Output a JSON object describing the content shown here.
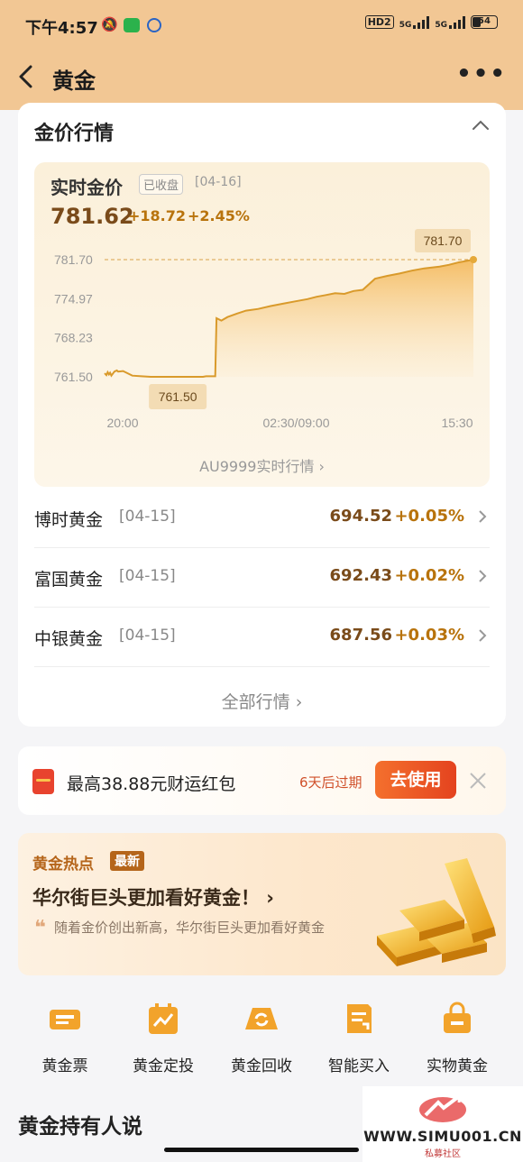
{
  "status_bar": {
    "time": "下午4:57",
    "hd": "HD2",
    "net1": "5G",
    "net2": "5G",
    "battery": "54"
  },
  "nav": {
    "title": "黄金"
  },
  "market": {
    "section_title": "金价行情",
    "realtime": {
      "title": "实时金价",
      "badge": "已收盘",
      "date": "[04-16]",
      "price": "781.62",
      "change": "+18.72",
      "change_pct": "+2.45%",
      "link": "AU9999实时行情"
    },
    "funds": [
      {
        "name": "博时黄金",
        "date": "[04-15]",
        "price": "694.52",
        "pct": "+0.05%"
      },
      {
        "name": "富国黄金",
        "date": "[04-15]",
        "price": "692.43",
        "pct": "+0.02%"
      },
      {
        "name": "中银黄金",
        "date": "[04-15]",
        "price": "687.56",
        "pct": "+0.03%"
      }
    ],
    "all_link": "全部行情"
  },
  "chart_data": {
    "type": "area",
    "y_ticks": [
      "781.70",
      "774.97",
      "768.23",
      "761.50"
    ],
    "x_ticks": [
      "20:00",
      "02:30/09:00",
      "15:30"
    ],
    "ylim": [
      761.5,
      781.7
    ],
    "high_label": "781.70",
    "low_label": "761.50",
    "x": [
      0,
      3,
      5,
      7,
      9,
      11,
      13,
      16,
      20,
      22,
      30,
      45,
      60,
      75,
      90,
      100,
      108,
      115,
      130,
      150,
      160,
      165,
      175,
      180,
      182,
      190,
      200,
      215,
      230,
      250,
      270,
      290,
      310,
      330,
      345,
      360,
      375,
      390,
      405,
      420,
      440,
      460,
      480,
      500,
      520,
      545,
      560,
      575,
      590,
      600
    ],
    "values": [
      762.1,
      761.8,
      762.3,
      761.9,
      762.2,
      761.7,
      762.0,
      762.4,
      762.6,
      762.4,
      762.5,
      761.7,
      761.6,
      761.5,
      761.5,
      761.5,
      761.5,
      761.5,
      761.5,
      761.5,
      761.5,
      761.6,
      761.6,
      761.6,
      771.6,
      771.2,
      771.8,
      772.4,
      772.9,
      773.2,
      773.7,
      774.1,
      774.5,
      774.9,
      775.3,
      775.6,
      775.9,
      775.8,
      776.3,
      776.5,
      778.4,
      778.9,
      779.3,
      779.8,
      780.2,
      780.5,
      780.8,
      781.2,
      781.5,
      781.7
    ],
    "color": "#e5a93a"
  },
  "packet": {
    "text": "最高38.88元财运红包",
    "expiry": "6天后过期",
    "button": "去使用"
  },
  "hot": {
    "tag": "黄金热点",
    "badge": "最新",
    "title": "华尔街巨头更加看好黄金！",
    "quote_mark": "❝",
    "subtitle": "随着金价创出新高，华尔街巨头更加看好黄金"
  },
  "shortcuts": [
    {
      "label": "黄金票",
      "icon": "ticket-icon"
    },
    {
      "label": "黄金定投",
      "icon": "calendar-chart-icon"
    },
    {
      "label": "黄金回收",
      "icon": "recycle-icon"
    },
    {
      "label": "智能买入",
      "icon": "document-icon"
    },
    {
      "label": "实物黄金",
      "icon": "bag-icon"
    }
  ],
  "holders_title": "黄金持有人说",
  "watermark": {
    "url": "WWW.SIMU001.CN",
    "sub": "私募社区"
  },
  "colors": {
    "header_bg": "#f2c794",
    "accent": "#b8730c",
    "price": "#7a4b1a",
    "button": "#e4431f"
  }
}
